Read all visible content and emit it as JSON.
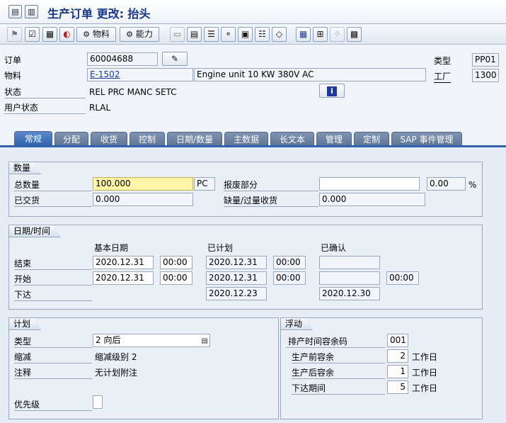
{
  "window": {
    "title": "生产订单 更改: 抬头"
  },
  "toolbar": {
    "material_label": "物料",
    "capacity_label": "能力"
  },
  "header": {
    "order_label": "订单",
    "order_value": "60004688",
    "material_label": "物料",
    "material_value": "E-1502",
    "material_desc": "Engine unit 10 KW 380V AC",
    "status_label": "状态",
    "status_value": "REL  PRC  MANC SETC",
    "user_status_label": "用户状态",
    "user_status_value": "RLAL",
    "type_label": "类型",
    "type_value": "PP01",
    "plant_label": "工厂",
    "plant_value": "1300"
  },
  "tabs": [
    "常规",
    "分配",
    "收货",
    "控制",
    "日期/数量",
    "主数据",
    "长文本",
    "管理",
    "定制",
    "SAP 事件管理"
  ],
  "quantity": {
    "group_title": "数量",
    "total_label": "总数量",
    "total_value": "100.000",
    "unit": "PC",
    "scrap_label": "报废部分",
    "scrap_value": "",
    "scrap_pct": "0.00",
    "pct_sign": "%",
    "delivered_label": "已交货",
    "delivered_value": "0.000",
    "short_label": "缺量/过量收货",
    "short_value": "0.000"
  },
  "dates": {
    "group_title": "日期/时间",
    "col_basic": "基本日期",
    "col_scheduled": "已计划",
    "col_confirmed": "已确认",
    "end_label": "结束",
    "start_label": "开始",
    "release_label": "下达",
    "end_basic_date": "2020.12.31",
    "end_basic_time": "00:00",
    "end_sched_date": "2020.12.31",
    "end_sched_time": "00:00",
    "start_basic_date": "2020.12.31",
    "start_basic_time": "00:00",
    "start_sched_date": "2020.12.31",
    "start_sched_time": "00:00",
    "start_conf_time": "00:00",
    "release_sched_date": "2020.12.23",
    "release_conf_date": "2020.12.30"
  },
  "planning": {
    "group_title": "计划",
    "type_label": "类型",
    "type_value": "2 向后",
    "reduction_label": "缩减",
    "reduction_value": "缩减级别 2",
    "note_label": "注释",
    "note_value": "无计划附注",
    "priority_label": "优先级",
    "priority_value": ""
  },
  "float": {
    "group_title": "浮动",
    "sched_margin_label": "排产时间容余码",
    "sched_margin_value": "001",
    "pre_label": "生产前容余",
    "pre_value": "2",
    "pre_unit": "工作日",
    "post_label": "生产后容余",
    "post_value": "1",
    "post_unit": "工作日",
    "release_label": "下达期间",
    "release_value": "5",
    "release_unit": "工作日"
  }
}
